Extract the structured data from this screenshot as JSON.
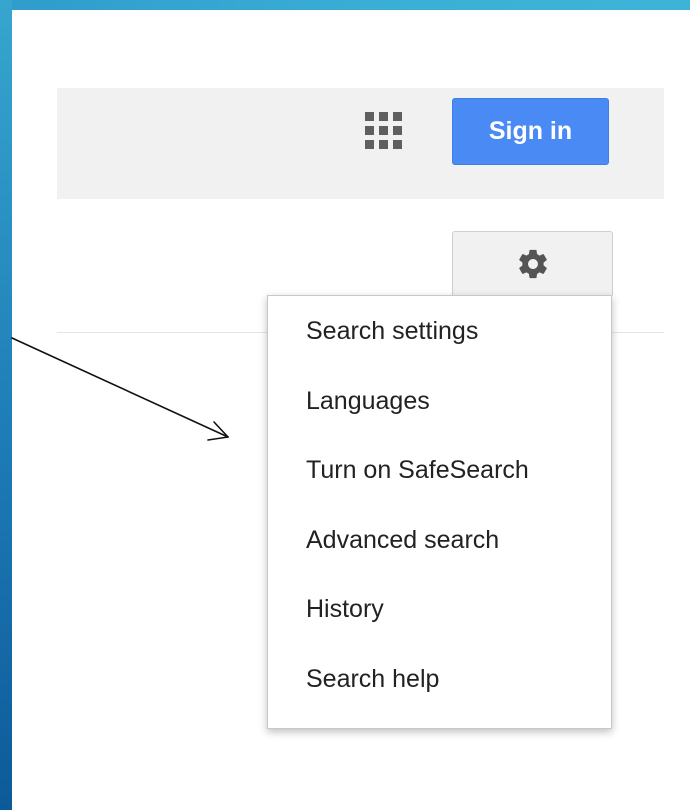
{
  "header": {
    "apps_icon": "apps-grid-icon",
    "signin_label": "Sign in",
    "colors": {
      "signin_bg": "#4a8af4",
      "bar_bg": "#f1f1f1"
    }
  },
  "settings": {
    "gear_icon": "gear-icon",
    "menu": {
      "items": [
        {
          "label": "Search settings"
        },
        {
          "label": "Languages"
        },
        {
          "label": "Turn on SafeSearch"
        },
        {
          "label": "Advanced search"
        },
        {
          "label": "History"
        },
        {
          "label": "Search help"
        }
      ]
    }
  },
  "annotation": {
    "arrow_icon": "pointer-arrow-icon"
  }
}
